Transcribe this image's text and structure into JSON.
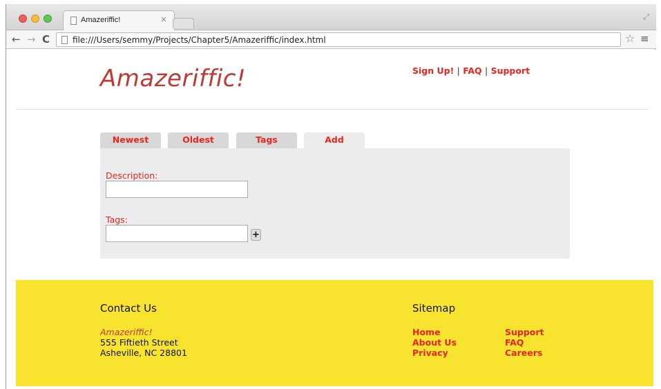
{
  "browser": {
    "tab_title": "Amazeriffic!",
    "tab_close": "×",
    "url": "file:///Users/semmy/Projects/Chapter5/Amazeriffic/index.html",
    "back": "←",
    "forward": "→",
    "reload": "C",
    "star": "☆",
    "menu": "≡",
    "resize": "⤢"
  },
  "header": {
    "logo": "Amazeriffic!",
    "nav": [
      "Sign Up!",
      "FAQ",
      "Support"
    ],
    "separator": "|"
  },
  "tabs": [
    {
      "label": "Newest",
      "active": false
    },
    {
      "label": "Oldest",
      "active": false
    },
    {
      "label": "Tags",
      "active": false
    },
    {
      "label": "Add",
      "active": true
    }
  ],
  "form": {
    "description_label": "Description:",
    "description_value": "",
    "tags_label": "Tags:",
    "tags_value": "",
    "add_button": "+"
  },
  "footer": {
    "contact_heading": "Contact Us",
    "company": "Amazeriffic!",
    "address_line1": "555 Fiftieth Street",
    "address_line2": "Asheville, NC 28801",
    "sitemap_heading": "Sitemap",
    "sitemap_col1": [
      "Home",
      "About Us",
      "Privacy"
    ],
    "sitemap_col2": [
      "Support",
      "FAQ",
      "Careers"
    ]
  },
  "colors": {
    "accent": "#e8261f",
    "logo": "#bd3a35",
    "footer_bg": "#f8e42f"
  }
}
